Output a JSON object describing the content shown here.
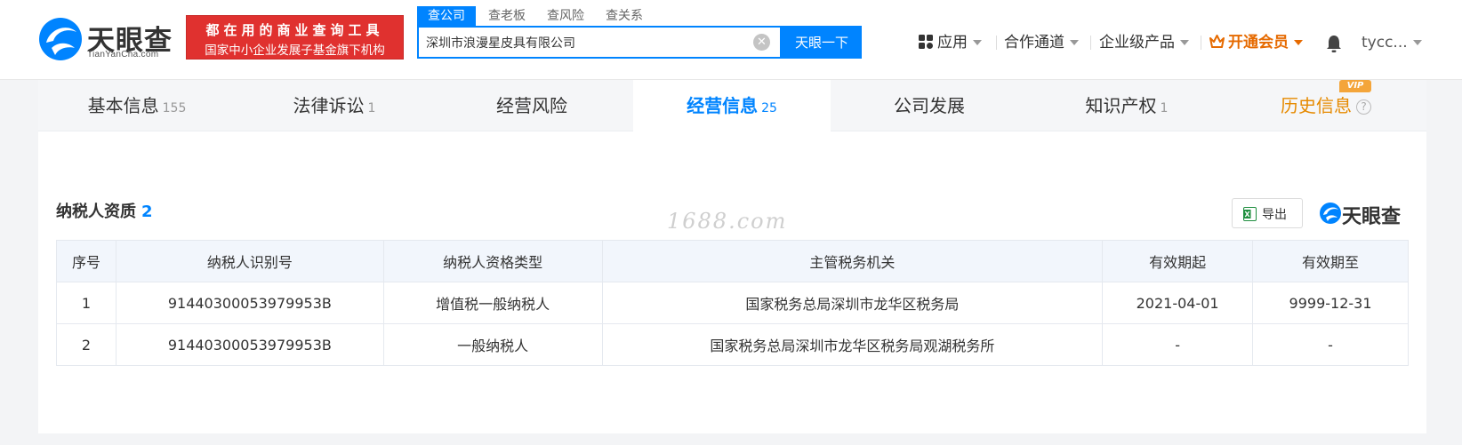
{
  "header": {
    "logo_text": "天眼查",
    "logo_sub": "TianYanCha.com",
    "banner_line1": "都在用的商业查询工具",
    "banner_line2": "国家中小企业发展子基金旗下机构",
    "search_tabs": [
      "查公司",
      "查老板",
      "查风险",
      "查关系"
    ],
    "search_value": "深圳市浪漫星皮具有限公司",
    "search_button": "天眼一下",
    "nav": {
      "apps": "应用",
      "channel": "合作通道",
      "enterprise": "企业级产品",
      "vip": "开通会员",
      "user": "tycc..."
    }
  },
  "tabs": [
    {
      "label": "基本信息",
      "count": "155"
    },
    {
      "label": "法律诉讼",
      "count": "1"
    },
    {
      "label": "经营风险",
      "count": ""
    },
    {
      "label": "经营信息",
      "count": "25"
    },
    {
      "label": "公司发展",
      "count": ""
    },
    {
      "label": "知识产权",
      "count": "1"
    },
    {
      "label": "历史信息",
      "count": ""
    }
  ],
  "vip_badge": "VIP",
  "section": {
    "title": "纳税人资质",
    "count": "2",
    "watermark": "1688.com",
    "export_label": "导出",
    "brand": "天眼查"
  },
  "table": {
    "headers": [
      "序号",
      "纳税人识别号",
      "纳税人资格类型",
      "主管税务机关",
      "有效期起",
      "有效期至"
    ],
    "rows": [
      [
        "1",
        "91440300053979953B",
        "增值税一般纳税人",
        "国家税务总局深圳市龙华区税务局",
        "2021-04-01",
        "9999-12-31"
      ],
      [
        "2",
        "91440300053979953B",
        "一般纳税人",
        "国家税务总局深圳市龙华区税务局观湖税务所",
        "-",
        "-"
      ]
    ]
  },
  "colors": {
    "accent": "#0084ff",
    "banner": "#e0312f",
    "vip": "#e66a00"
  }
}
